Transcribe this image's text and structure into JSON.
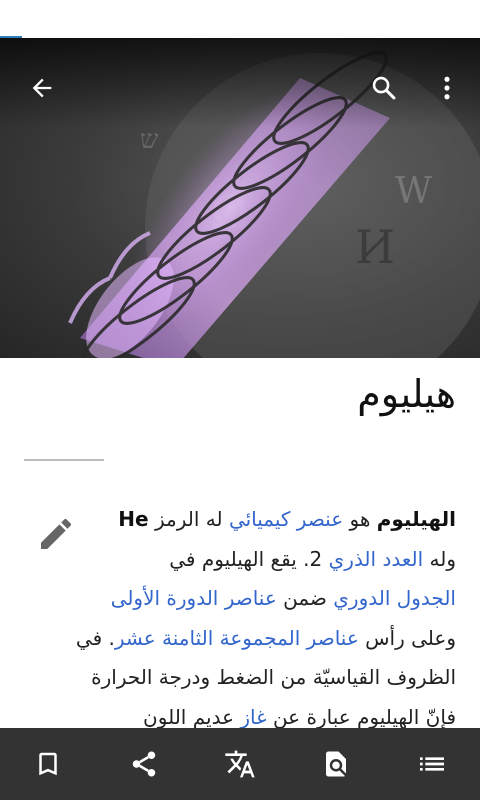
{
  "colors": {
    "link": "#3366cc",
    "toolbar_bg": "#333333",
    "hero_glow": "#c98ee6",
    "status_accent": "#2a7fb8"
  },
  "toolbar": {
    "back_icon": "arrow-left-icon",
    "search_icon": "search-icon",
    "overflow_icon": "more-vertical-icon"
  },
  "article": {
    "title": "هيليوم",
    "lines": [
      [
        {
          "t": "b",
          "text": "الهيليوم"
        },
        {
          "t": "s",
          "text": " هو "
        },
        {
          "t": "a",
          "text": "عنصر كيميائي"
        },
        {
          "t": "s",
          "text": " له الرمز "
        },
        {
          "t": "b",
          "text": "He"
        }
      ],
      [
        {
          "t": "s",
          "text": "وله "
        },
        {
          "t": "a",
          "text": "العدد الذري"
        },
        {
          "t": "s",
          "text": " 2. يقع الهيليوم في"
        }
      ],
      [
        {
          "t": "a",
          "text": "الجدول الدوري"
        },
        {
          "t": "s",
          "text": " ضمن "
        },
        {
          "t": "a",
          "text": "عناصر الدورة الأولى"
        }
      ],
      [
        {
          "t": "s",
          "text": "وعلى رأس "
        },
        {
          "t": "a",
          "text": "عناصر المجموعة الثامنة عشر"
        },
        {
          "t": "s",
          "text": ". في"
        }
      ],
      [
        {
          "t": "s",
          "text": "الظروف القياسيّة من الضغط ودرجة الحرارة"
        }
      ],
      [
        {
          "t": "s",
          "text": "فإنّ الهيليوم عبارة عن "
        },
        {
          "t": "a",
          "text": "غاز"
        },
        {
          "t": "s",
          "text": " عديم اللون"
        }
      ]
    ]
  },
  "bottom_bar": [
    {
      "icon": "bookmark-icon"
    },
    {
      "icon": "share-icon"
    },
    {
      "icon": "translate-icon"
    },
    {
      "icon": "find-in-page-icon"
    },
    {
      "icon": "table-of-contents-icon"
    }
  ]
}
